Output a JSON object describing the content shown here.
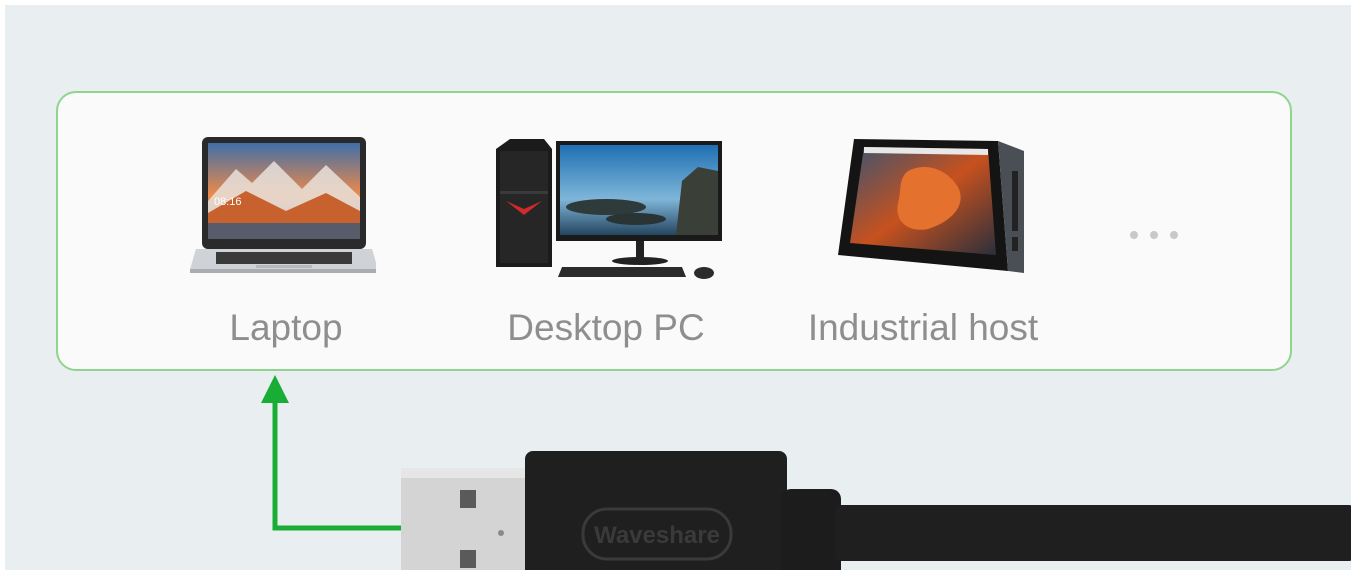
{
  "devices": [
    {
      "label": "Laptop",
      "icon": "laptop-icon"
    },
    {
      "label": "Desktop PC",
      "icon": "desktop-pc-icon"
    },
    {
      "label": "Industrial host",
      "icon": "industrial-host-icon"
    }
  ],
  "more_icon": "ellipsis-icon",
  "cable": {
    "brand": "Waveshare"
  },
  "colors": {
    "panel_border": "#8fd48f",
    "arrow": "#1aad36",
    "label": "#8e8e8e",
    "cable": "#1f1f1f"
  }
}
